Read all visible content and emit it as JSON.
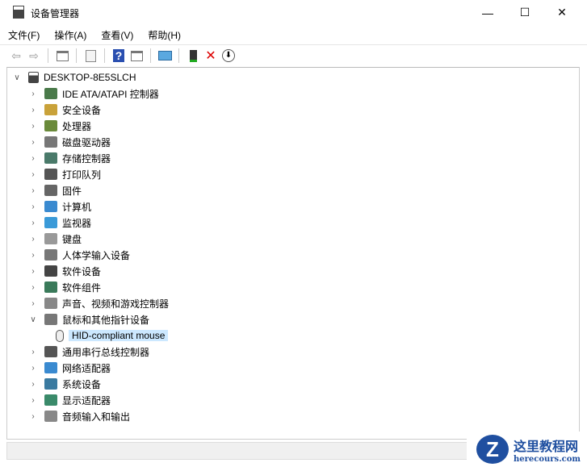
{
  "window": {
    "title": "设备管理器",
    "minimize": "—",
    "maximize": "☐",
    "close": "✕"
  },
  "menu": [
    "文件(F)",
    "操作(A)",
    "查看(V)",
    "帮助(H)"
  ],
  "toolbar": {
    "back": "⇦",
    "forward": "⇨",
    "help": "?",
    "remove": "✕",
    "update": "⬇"
  },
  "tree": {
    "root": "DESKTOP-8E5SLCH",
    "items": [
      {
        "label": "IDE ATA/ATAPI 控制器",
        "color": "#4a7a4a"
      },
      {
        "label": "安全设备",
        "color": "#c9a23a"
      },
      {
        "label": "处理器",
        "color": "#6a8a3a"
      },
      {
        "label": "磁盘驱动器",
        "color": "#777777"
      },
      {
        "label": "存储控制器",
        "color": "#4a7a6a"
      },
      {
        "label": "打印队列",
        "color": "#555555"
      },
      {
        "label": "固件",
        "color": "#666666"
      },
      {
        "label": "计算机",
        "color": "#3a8ad0"
      },
      {
        "label": "监视器",
        "color": "#3a9ad8"
      },
      {
        "label": "键盘",
        "color": "#999999"
      },
      {
        "label": "人体学输入设备",
        "color": "#777777"
      },
      {
        "label": "软件设备",
        "color": "#444444"
      },
      {
        "label": "软件组件",
        "color": "#3a7a5a"
      },
      {
        "label": "声音、视频和游戏控制器",
        "color": "#888888"
      },
      {
        "label": "鼠标和其他指针设备",
        "color": "#777777",
        "expanded": true,
        "children": [
          "HID-compliant mouse"
        ]
      },
      {
        "label": "通用串行总线控制器",
        "color": "#555555"
      },
      {
        "label": "网络适配器",
        "color": "#3a8ad0"
      },
      {
        "label": "系统设备",
        "color": "#3a7aa0"
      },
      {
        "label": "显示适配器",
        "color": "#3a8a6a"
      },
      {
        "label": "音频输入和输出",
        "color": "#888888"
      }
    ]
  },
  "watermark": {
    "title": "这里教程网",
    "url": "herecours.com",
    "logo": "Z"
  }
}
